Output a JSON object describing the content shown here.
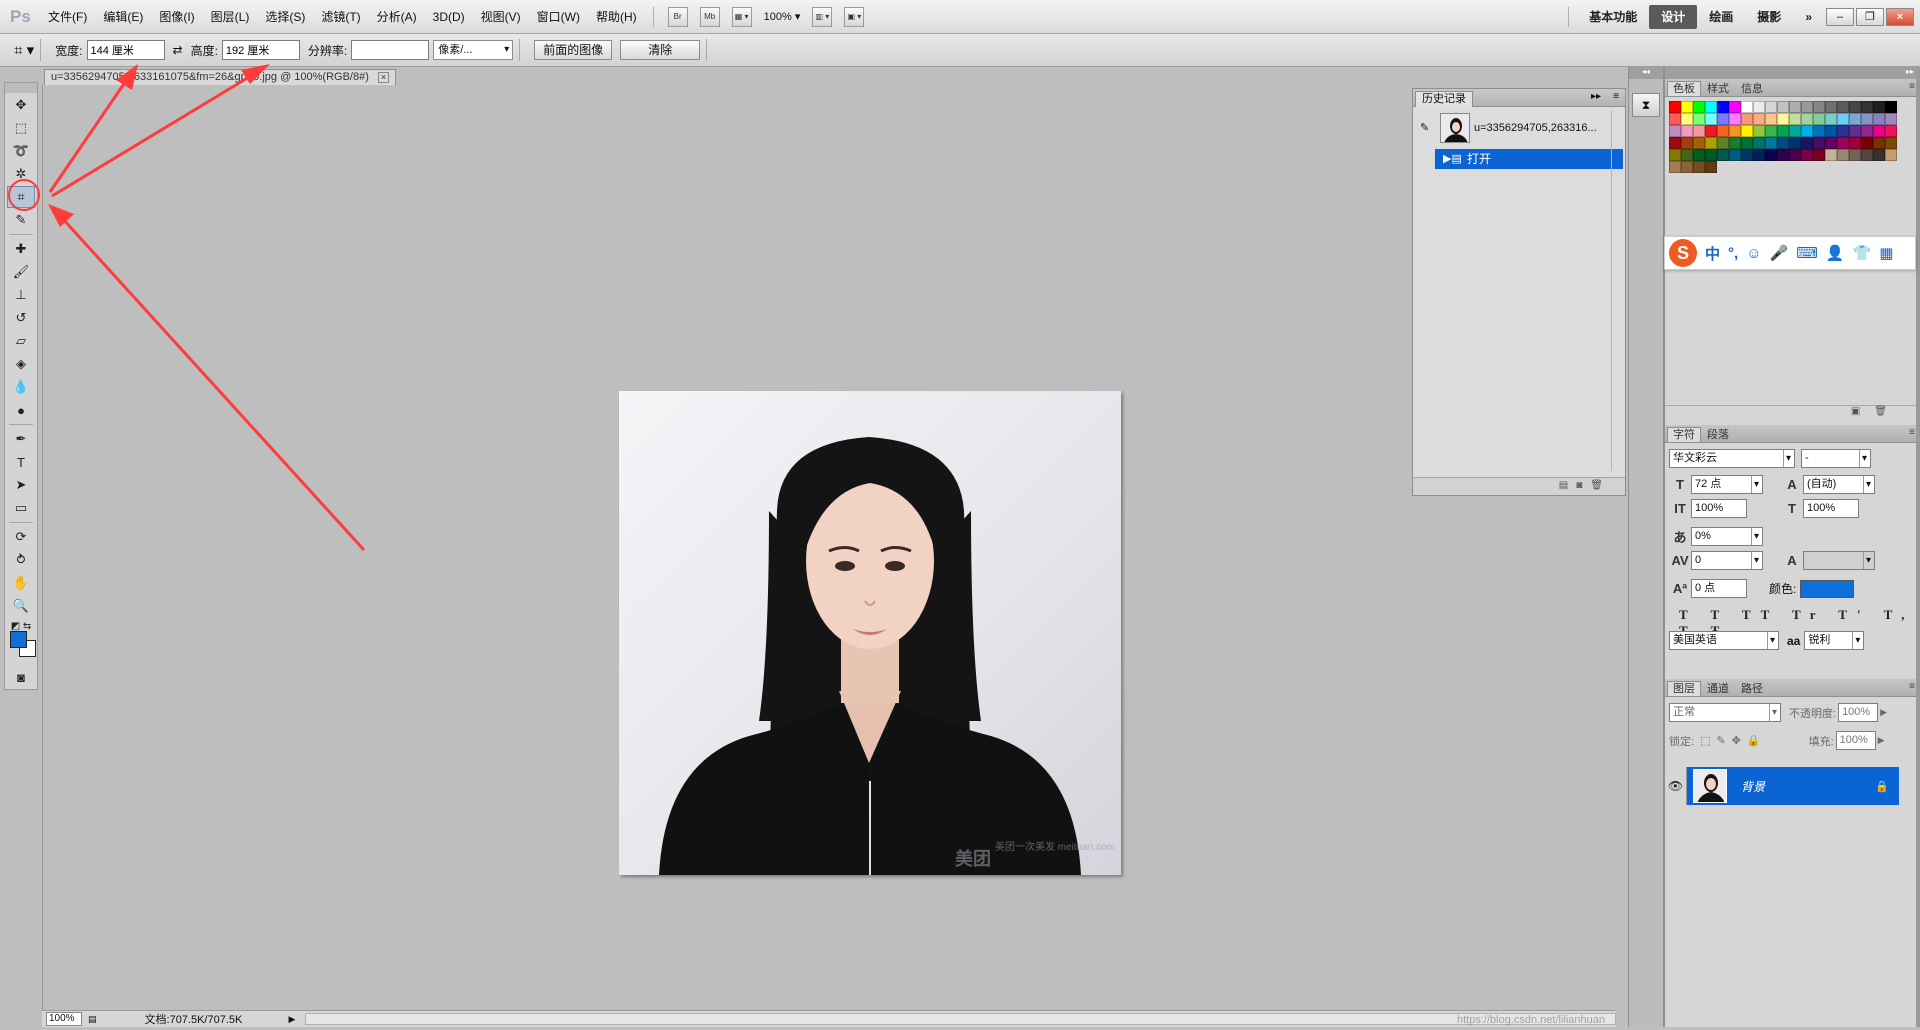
{
  "app": {
    "logo": "Ps",
    "menu": [
      "文件(F)",
      "编辑(E)",
      "图像(I)",
      "图层(L)",
      "选择(S)",
      "滤镜(T)",
      "分析(A)",
      "3D(D)",
      "视图(V)",
      "窗口(W)",
      "帮助(H)"
    ],
    "mini_buttons": [
      "Br",
      "Mb"
    ],
    "zoom_level": "100%",
    "workspaces": [
      "基本功能",
      "设计",
      "绘画",
      "摄影"
    ],
    "active_workspace": "设计",
    "more": "»"
  },
  "options": {
    "width_label": "宽度:",
    "width_value": "144 厘米",
    "swap_icon": "⇄",
    "height_label": "高度:",
    "height_value": "192 厘米",
    "resolution_label": "分辨率:",
    "resolution_value": "",
    "unit_value": "像素/...",
    "front_image_button": "前面的图像",
    "clear_button": "清除"
  },
  "document": {
    "tab_title": "u=3356294705,2633161075&fm=26&gp=0.jpg @ 100%(RGB/8#)",
    "tab_close": "×",
    "watermark": "美团",
    "watermark_small": "美团一次美发 meituan.com"
  },
  "status": {
    "zoom": "100%",
    "doc_info": "文档:707.5K/707.5K",
    "credit": "https://blog.csdn.net/lilianhuan"
  },
  "history": {
    "tab": "历史记录",
    "snapshot_name": "u=3356294705,263316...",
    "step_name": "打开"
  },
  "swatches": {
    "tabs": [
      "色板",
      "样式",
      "信息"
    ],
    "colors": [
      "#ff0000",
      "#ffff00",
      "#00ff00",
      "#00ffff",
      "#0000ff",
      "#ff00ff",
      "#ffffff",
      "#ebebeb",
      "#d6d6d6",
      "#c2c2c2",
      "#adadad",
      "#999999",
      "#858585",
      "#707070",
      "#5c5c5c",
      "#474747",
      "#333333",
      "#1f1f1f",
      "#000000",
      "#ff5a5a",
      "#ffff7a",
      "#7aff7a",
      "#7affff",
      "#7a7aff",
      "#ff7aff",
      "#f7977a",
      "#f9ad81",
      "#fdc68a",
      "#fff79a",
      "#c4df9b",
      "#a3d39c",
      "#82ca9d",
      "#7bcdc8",
      "#6ecff6",
      "#7ea7d8",
      "#8493ca",
      "#8882be",
      "#a187be",
      "#bc8dbf",
      "#f49ac2",
      "#f6989d",
      "#ed1c24",
      "#f26522",
      "#f7941d",
      "#fff200",
      "#8dc63f",
      "#39b54a",
      "#00a651",
      "#00a99d",
      "#00aeef",
      "#0072bc",
      "#0054a6",
      "#2e3192",
      "#662d91",
      "#92278f",
      "#ec008c",
      "#ed145b",
      "#9e0b0f",
      "#a0410d",
      "#a36209",
      "#aba000",
      "#598527",
      "#1a7b30",
      "#007236",
      "#00746b",
      "#0076a3",
      "#004b80",
      "#003471",
      "#1b1464",
      "#440e62",
      "#630460",
      "#9e005d",
      "#9e0039",
      "#790000",
      "#7b2e00",
      "#7d4900",
      "#827b00",
      "#406618",
      "#005e20",
      "#005826",
      "#005952",
      "#005b7f",
      "#003663",
      "#002157",
      "#0d004c",
      "#32004b",
      "#4b0049",
      "#7b0046",
      "#7a0026",
      "#c7b299",
      "#998675",
      "#736357",
      "#534741",
      "#37302d",
      "#c69c6d",
      "#a67c52",
      "#8c6239",
      "#754c24",
      "#603913"
    ]
  },
  "ime": {
    "logo": "S",
    "items": [
      "中",
      "°,",
      "☺",
      "🎤",
      "⌨",
      "👤",
      "👕",
      "▦"
    ]
  },
  "character": {
    "tabs": [
      "字符",
      "段落"
    ],
    "font_family": "华文彩云",
    "font_style": "-",
    "font_size": "72 点",
    "leading": "(自动)",
    "vertical_scale": "100%",
    "horizontal_scale": "100%",
    "tsume": "0%",
    "tracking": "0",
    "kerning": "",
    "baseline": "0 点",
    "color_label": "颜色:",
    "text_styles": "T T TT Tr T' T, T Ŧ",
    "language": "美国英语",
    "aa_label": "aa",
    "antialias": "锐利"
  },
  "layers": {
    "tabs": [
      "图层",
      "通道",
      "路径"
    ],
    "blend_mode": "正常",
    "opacity_label": "不透明度:",
    "opacity": "100%",
    "lock_label": "锁定:",
    "fill_label": "填充:",
    "fill": "100%",
    "layer_name": "背景"
  },
  "annotations": {
    "arrow_color": "#ff3b3b"
  }
}
